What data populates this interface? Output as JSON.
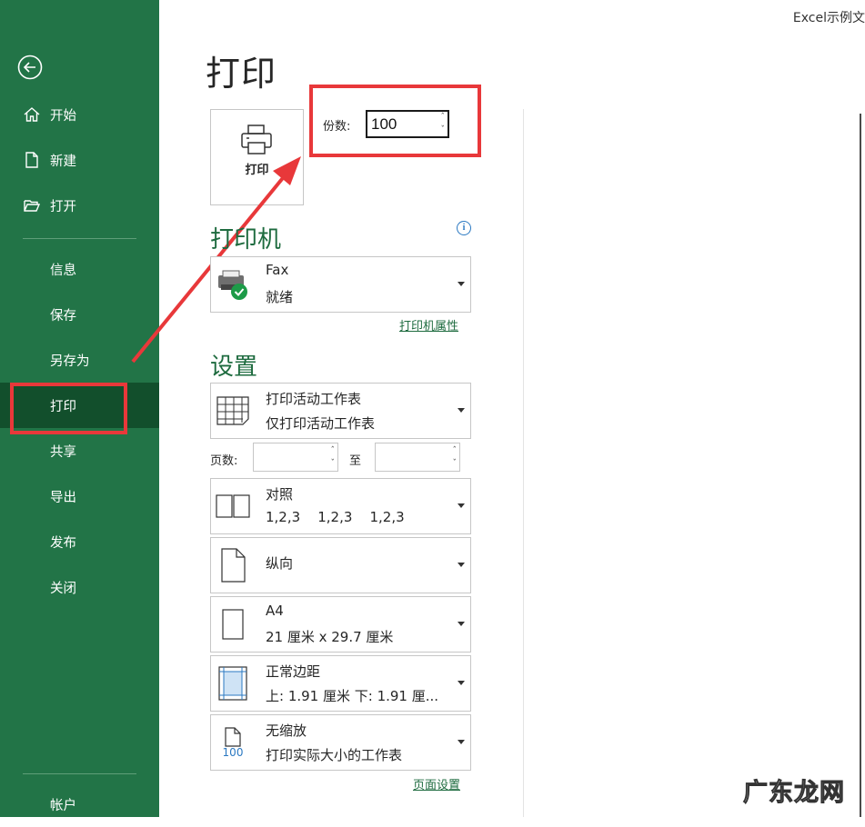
{
  "window": {
    "title": "Excel示例文"
  },
  "sidebar": {
    "top_items": [
      {
        "label": "开始",
        "icon": "home-icon"
      },
      {
        "label": "新建",
        "icon": "new-file-icon"
      },
      {
        "label": "打开",
        "icon": "folder-open-icon"
      }
    ],
    "items": [
      "信息",
      "保存",
      "另存为",
      "打印",
      "共享",
      "导出",
      "发布",
      "关闭"
    ],
    "active": "打印",
    "bottom_item": "帐户"
  },
  "main": {
    "title": "打印",
    "print_button_label": "打印",
    "copies": {
      "label": "份数:",
      "value": "100"
    },
    "printer": {
      "heading": "打印机",
      "name": "Fax",
      "status": "就绪",
      "properties_link": "打印机属性"
    },
    "settings": {
      "heading": "设置",
      "what_to_print": {
        "line1": "打印活动工作表",
        "line2": "仅打印活动工作表"
      },
      "pages": {
        "label": "页数:",
        "to_label": "至",
        "from_value": "",
        "to_value": ""
      },
      "collation": {
        "line1": "对照",
        "line2": "1,2,3    1,2,3    1,2,3"
      },
      "orientation": {
        "line1": "纵向"
      },
      "paper": {
        "line1": "A4",
        "line2": "21 厘米 x 29.7 厘米"
      },
      "margins": {
        "line1": "正常边距",
        "line2": "上: 1.91 厘米 下: 1.91 厘..."
      },
      "scaling": {
        "line1": "无缩放",
        "line2": "打印实际大小的工作表",
        "icon_text": "100"
      },
      "page_setup_link": "页面设置"
    }
  },
  "watermark": "广东龙网",
  "colors": {
    "sidebar": "#227447",
    "sidebar_active": "#124f2c",
    "accent_green": "#1e6b3f",
    "annotation_red": "#e8383a"
  }
}
